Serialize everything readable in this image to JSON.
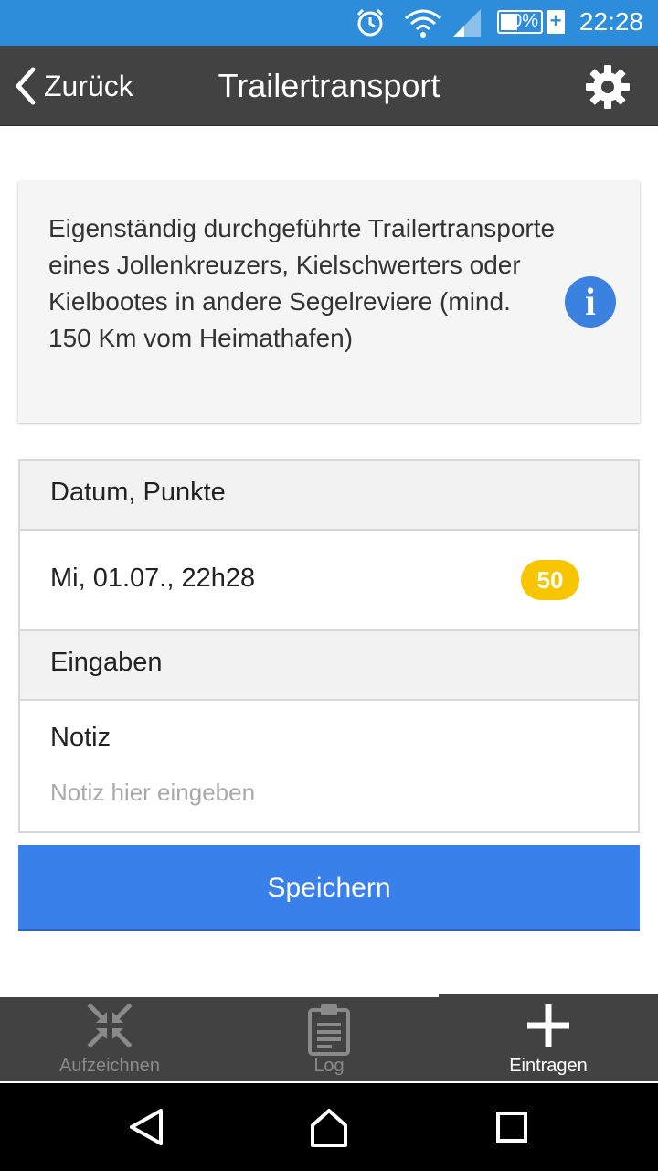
{
  "status_bar": {
    "time": "22:28",
    "battery_percent": "40%",
    "icons": [
      "alarm-icon",
      "wifi-icon",
      "signal-icon",
      "battery-icon",
      "charging-icon"
    ]
  },
  "app_bar": {
    "back_label": "Zurück",
    "title": "Trailertransport",
    "settings_icon": "gear-icon"
  },
  "info_card": {
    "description": "Eigenständig durchgeführte Trailertransporte eines Jollenkreuzers, Kielschwerters oder Kielbootes in andere Segelreviere (mind. 150 Km vom Heimathafen)",
    "info_icon_glyph": "i"
  },
  "form": {
    "section_date_points": "Datum, Punkte",
    "date_value": "Mi, 01.07., 22h28",
    "points_badge": "50",
    "section_inputs": "Eingaben",
    "note_label": "Notiz",
    "note_value": "",
    "note_placeholder": "Notiz hier eingeben"
  },
  "save_button": {
    "label": "Speichern"
  },
  "tab_bar": {
    "tabs": [
      {
        "label": "Aufzeichnen",
        "icon": "collapse-arrows-icon",
        "active": false
      },
      {
        "label": "Log",
        "icon": "clipboard-icon",
        "active": false
      },
      {
        "label": "Eintragen",
        "icon": "plus-icon",
        "active": true
      }
    ]
  },
  "nav_bar": {
    "buttons": [
      "back-triangle-icon",
      "home-icon",
      "recents-square-icon"
    ]
  },
  "colors": {
    "status_bar": "#2d8ddb",
    "app_bar": "#424242",
    "accent_blue": "#3a80ea",
    "badge_yellow": "#f7c600",
    "info_blue": "#3b82e0"
  }
}
